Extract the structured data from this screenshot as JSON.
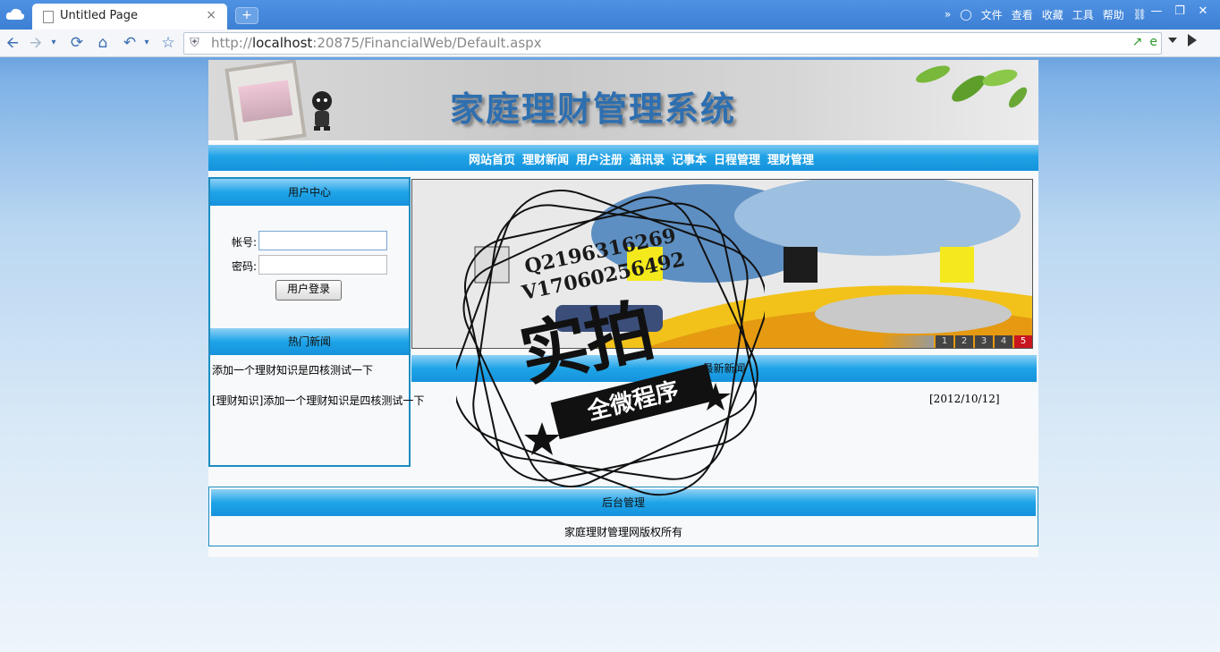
{
  "browser": {
    "tab_title": "Untitled Page",
    "tab_close": "×",
    "new_tab": "+",
    "menu": [
      "文件",
      "查看",
      "收藏",
      "工具",
      "帮助"
    ],
    "menu_more": "»",
    "url_host": "localhost",
    "url_prefix": "http://",
    "url_rest": ":20875/FinancialWeb/Default.aspx"
  },
  "site": {
    "title": "家庭理财管理系统",
    "nav": [
      "网站首页",
      "理财新闻",
      "用户注册",
      "通讯录",
      "记事本",
      "日程管理",
      "理财管理"
    ]
  },
  "login": {
    "header": "用户中心",
    "account_label": "帐号:",
    "password_label": "密码:",
    "account_value": "",
    "password_value": "",
    "button": "用户登录"
  },
  "hot_news": {
    "header": "热门新闻",
    "items": [
      "添加一个理财知识是四核测试一下"
    ]
  },
  "slideshow": {
    "pages": [
      "1",
      "2",
      "3",
      "4",
      "5"
    ],
    "active_page": "5"
  },
  "latest_news": {
    "header": "最新新闻",
    "items": [
      {
        "title": "[理财知识]添加一个理财知识是四核测试一下",
        "date": "[2012/10/12]"
      }
    ]
  },
  "admin": {
    "header": "后台管理",
    "copyright": "家庭理财管理网版权所有"
  },
  "watermark": {
    "line1": "Q2196316269",
    "line2": "V17060256492",
    "big": "实拍",
    "ribbon": "全微程序"
  },
  "colors": {
    "nav_blue": "#1592dc",
    "border_blue": "#1c8cc0",
    "pager_active": "#c8161e"
  }
}
